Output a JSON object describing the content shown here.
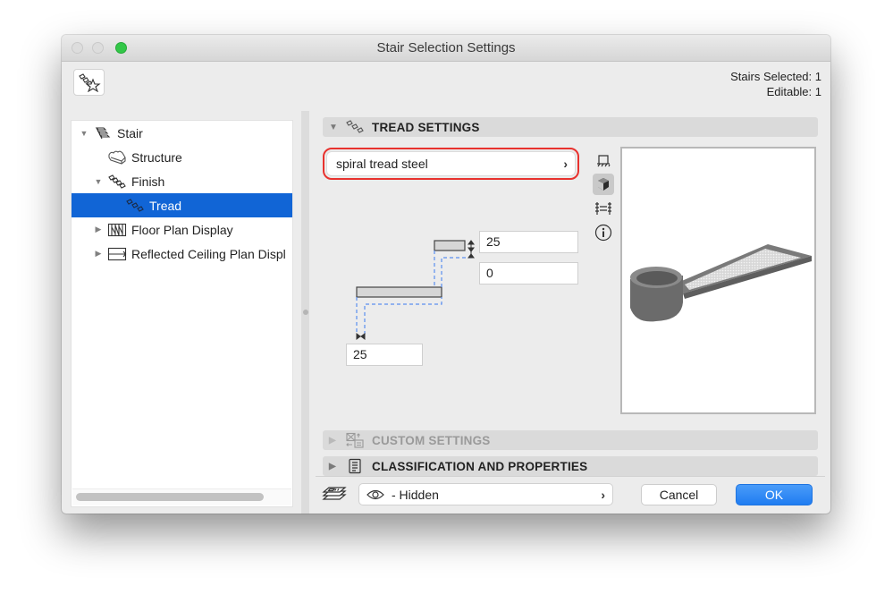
{
  "window": {
    "title": "Stair Selection Settings"
  },
  "header": {
    "favorites_icon": "favorites-star-icon",
    "stairs_selected": "Stairs Selected: 1",
    "editable": "Editable: 1"
  },
  "tree": {
    "items": [
      {
        "label": "Stair",
        "icon": "stair-icon",
        "expanded": true,
        "level": 0,
        "selected": false
      },
      {
        "label": "Structure",
        "icon": "structure-icon",
        "expanded": null,
        "level": 1,
        "selected": false
      },
      {
        "label": "Finish",
        "icon": "finish-icon",
        "expanded": true,
        "level": 1,
        "selected": false
      },
      {
        "label": "Tread",
        "icon": "tread-icon",
        "expanded": null,
        "level": 2,
        "selected": true
      },
      {
        "label": "Floor Plan Display",
        "icon": "floor-plan-icon",
        "expanded": false,
        "level": 1,
        "selected": false
      },
      {
        "label": "Reflected Ceiling Plan Displ",
        "icon": "ceiling-plan-icon",
        "expanded": false,
        "level": 1,
        "selected": false
      }
    ]
  },
  "panel": {
    "sections": [
      {
        "label": "TREAD SETTINGS",
        "icon": "tread-icon",
        "expanded": true,
        "enabled": true
      },
      {
        "label": "CUSTOM SETTINGS",
        "icon": "custom-settings-icon",
        "expanded": false,
        "enabled": false
      },
      {
        "label": "CLASSIFICATION AND PROPERTIES",
        "icon": "document-list-icon",
        "expanded": false,
        "enabled": true
      }
    ],
    "preset": {
      "value": "spiral tread steel",
      "highlight_color": "#e8322e"
    },
    "side_icons": [
      {
        "name": "floor-plan-view-icon",
        "active": false
      },
      {
        "name": "3d-view-icon",
        "active": true
      },
      {
        "name": "section-view-icon",
        "active": false
      },
      {
        "name": "info-icon",
        "active": false
      }
    ],
    "fields": {
      "thickness": "25",
      "offset": "0",
      "nosing": "25"
    }
  },
  "footer": {
    "layer_icon": "layers-icon",
    "layer_visibility_icon": "eye-icon",
    "layer_value": "- Hidden",
    "cancel_label": "Cancel",
    "ok_label": "OK",
    "accent_color": "#1f7cf1"
  }
}
